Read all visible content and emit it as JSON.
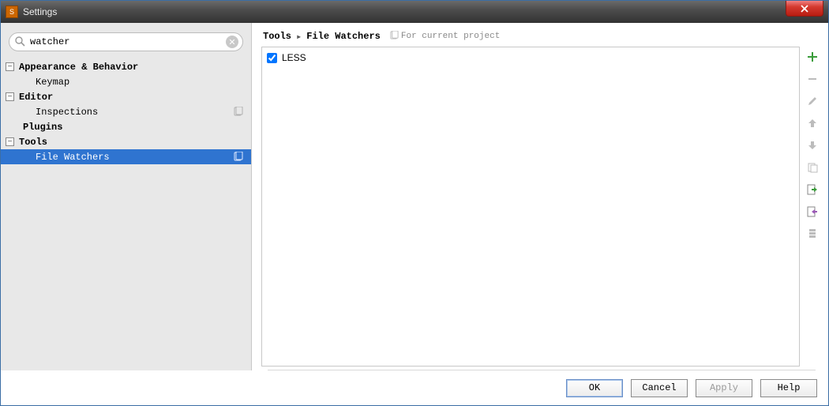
{
  "window": {
    "title": "Settings"
  },
  "search": {
    "value": "watcher",
    "placeholder": ""
  },
  "sidebar": {
    "items": [
      {
        "label": "Appearance & Behavior",
        "bold": true,
        "expand": "-"
      },
      {
        "label": "Keymap"
      },
      {
        "label": "Editor",
        "bold": true,
        "expand": "-"
      },
      {
        "label": "Inspections",
        "badge": true
      },
      {
        "label": "Plugins",
        "bold": true
      },
      {
        "label": "Tools",
        "bold": true,
        "expand": "-"
      },
      {
        "label": "File Watchers",
        "selected": true,
        "badge": true
      }
    ]
  },
  "breadcrumb": {
    "crumb1": "Tools",
    "crumb2": "File Watchers",
    "scope": "For current project"
  },
  "watchers": [
    {
      "name": "LESS",
      "checked": true
    }
  ],
  "toolbar": {
    "add": "add",
    "remove": "remove",
    "edit": "edit",
    "up": "up",
    "down": "down",
    "copy": "copy",
    "import": "import",
    "export": "export"
  },
  "buttons": {
    "ok": "OK",
    "cancel": "Cancel",
    "apply": "Apply",
    "help": "Help"
  }
}
